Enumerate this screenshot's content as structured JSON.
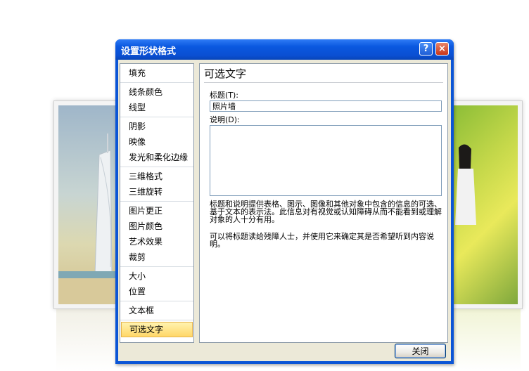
{
  "dialog": {
    "title": "设置形状格式",
    "help_label": "?",
    "close_label": "×"
  },
  "nav": {
    "groups": [
      [
        "填充"
      ],
      [
        "线条颜色",
        "线型"
      ],
      [
        "阴影",
        "映像",
        "发光和柔化边缘"
      ],
      [
        "三维格式",
        "三维旋转"
      ],
      [
        "图片更正",
        "图片颜色",
        "艺术效果",
        "裁剪"
      ],
      [
        "大小",
        "位置"
      ],
      [
        "文本框"
      ],
      [
        "可选文字"
      ]
    ],
    "selected": "可选文字"
  },
  "panel": {
    "heading": "可选文字",
    "title_label": "标题(T):",
    "title_value": "照片墙",
    "desc_label": "说明(D):",
    "desc_value": "",
    "info1": "标题和说明提供表格、图示、图像和其他对象中包含的信息的可选、基于文本的表示法。此信息对有视觉或认知障碍从而不能看到或理解对象的人十分有用。",
    "info2": "可以将标题读给残障人士，并使用它来确定其是否希望听到内容说明。"
  },
  "footer": {
    "close_button": "关闭"
  },
  "colors": {
    "titlebar": "#0a58e0",
    "selected_item": "#ffd768",
    "client_bg": "#ece9d8"
  }
}
